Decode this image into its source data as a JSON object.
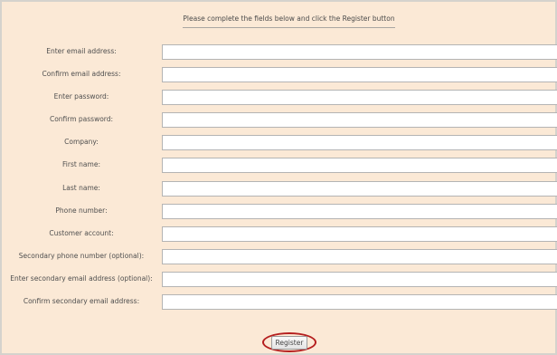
{
  "form": {
    "instructions": "Please complete the fields below and click the Register button",
    "fields": [
      {
        "label": "Enter email address:",
        "value": ""
      },
      {
        "label": "Confirm email address:",
        "value": ""
      },
      {
        "label": "Enter password:",
        "value": ""
      },
      {
        "label": "Confirm password:",
        "value": ""
      },
      {
        "label": "Company:",
        "value": ""
      },
      {
        "label": "First name:",
        "value": ""
      },
      {
        "label": "Last name:",
        "value": ""
      },
      {
        "label": "Phone number:",
        "value": ""
      },
      {
        "label": "Customer account:",
        "value": ""
      },
      {
        "label": "Secondary phone number (optional):",
        "value": ""
      },
      {
        "label": "Enter secondary email address (optional):",
        "value": ""
      },
      {
        "label": "Confirm secondary email address:",
        "value": ""
      }
    ],
    "register_label": "Register"
  },
  "colors": {
    "panel_background": "#fbe9d6",
    "highlight_ring": "#b51f1f"
  }
}
